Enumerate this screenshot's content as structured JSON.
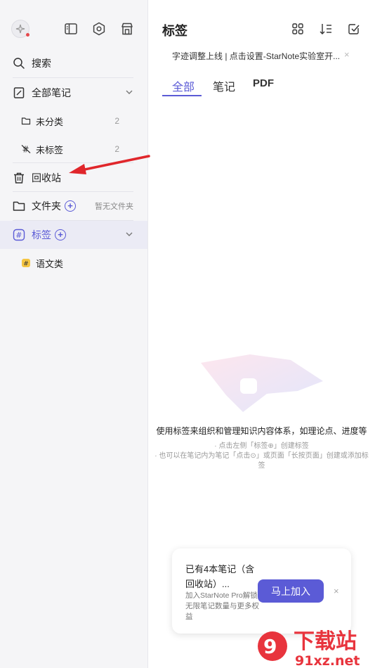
{
  "sidebar": {
    "search_label": "搜索",
    "all_notes_label": "全部笔记",
    "uncategorized": {
      "label": "未分类",
      "count": "2"
    },
    "untagged": {
      "label": "未标签",
      "count": "2"
    },
    "trash_label": "回收站",
    "folders": {
      "label": "文件夹",
      "note": "暂无文件夹"
    },
    "tags_label": "标签",
    "tag_items": [
      {
        "label": "语文类"
      }
    ]
  },
  "main": {
    "title": "标签",
    "banner_text": "字迹调整上线 | 点击设置-StarNote实验室开...",
    "banner_close": "×",
    "tabs": [
      {
        "label": "全部"
      },
      {
        "label": "笔记"
      },
      {
        "label": "PDF"
      }
    ],
    "empty": {
      "main_text": "使用标签来组织和管理知识内容体系，如理论点、进度等",
      "line1": "· 点击左侧「标签⊕」创建标签",
      "line2": "· 也可以在笔记内为笔记「点击⊙」或页面「长按页面」创建或添加标",
      "line3": "签"
    }
  },
  "promo": {
    "title": "已有4本笔记（含回收站）...",
    "desc": "加入StarNote Pro解锁无限笔记数量与更多权益",
    "button": "马上加入",
    "close": "×"
  },
  "watermark": {
    "text1": "下载站",
    "text2": "91xz.net"
  },
  "colors": {
    "accent": "#5b5bd6",
    "sidebar_bg": "#f5f5f7",
    "arrow": "#e0262b"
  }
}
